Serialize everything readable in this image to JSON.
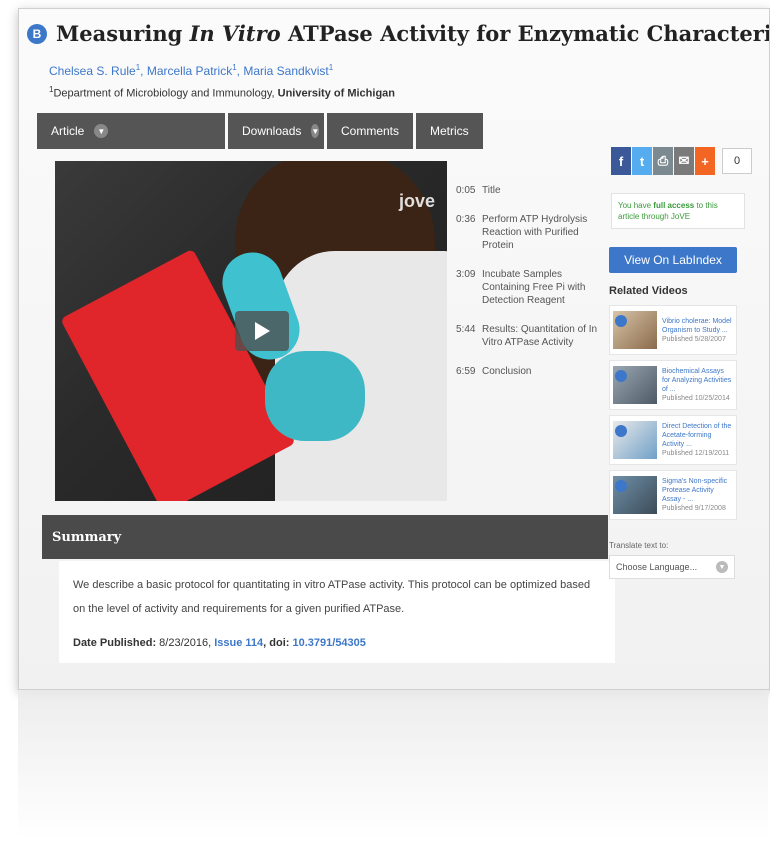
{
  "article": {
    "badge": "B",
    "title_pre": "Measuring ",
    "title_em": "In Vitro",
    "title_post": " ATPase Activity for Enzymatic Characterization",
    "authors": [
      {
        "name": "Chelsea S. Rule",
        "sup": "1"
      },
      {
        "name": "Marcella Patrick",
        "sup": "1"
      },
      {
        "name": "Maria Sandkvist",
        "sup": "1"
      }
    ],
    "affiliation_sup": "1",
    "affiliation_dept": "Department of Microbiology and Immunology, ",
    "affiliation_univ": "University of Michigan"
  },
  "tabs": {
    "article": "Article",
    "downloads": "Downloads",
    "comments": "Comments",
    "metrics": "Metrics"
  },
  "video": {
    "logo": "jove",
    "chapters": [
      {
        "time": "0:05",
        "label": "Title"
      },
      {
        "time": "0:36",
        "label": "Perform ATP Hydrolysis Reaction with Purified Protein"
      },
      {
        "time": "3:09",
        "label": "Incubate Samples Containing Free Pi with Detection Reagent"
      },
      {
        "time": "5:44",
        "label": "Results: Quantitation of In Vitro ATPase Activity"
      },
      {
        "time": "6:59",
        "label": "Conclusion"
      }
    ]
  },
  "social": {
    "count": "0",
    "colors": {
      "facebook": "#3b5998",
      "twitter": "#55acee",
      "print": "#7a8a90",
      "email": "#7a7a7a",
      "plus": "#f26522"
    }
  },
  "sidebar": {
    "access_pre": "You have ",
    "access_bold": "full access",
    "access_post": " to this article through JoVE",
    "labindex_button": "View On LabIndex",
    "related_heading": "Related Videos",
    "related": [
      {
        "title": "Vibrio cholerae: Model Organism to Study ...",
        "published": "Published 5/28/2007"
      },
      {
        "title": "Biochemical Assays for Analyzing Activities of ...",
        "published": "Published 10/25/2014"
      },
      {
        "title": "Direct Detection of the Acetate-forming Activity ...",
        "published": "Published 12/19/2011"
      },
      {
        "title": "Sigma's Non-specific Protease Activity Assay - ...",
        "published": "Published 9/17/2008"
      }
    ],
    "translate_label": "Translate text to:",
    "language_placeholder": "Choose Language..."
  },
  "summary": {
    "heading": "Summary",
    "text": "We describe a basic protocol for quantitating in vitro ATPase activity. This protocol can be optimized based on the level of activity and requirements for a given purified ATPase.",
    "date_label": "Date Published:",
    "date_value": " 8/23/2016, ",
    "issue": "Issue 114",
    "doi_label": ", doi: ",
    "doi": "10.3791/54305"
  },
  "colors": {
    "accent": "#3d77c9",
    "tab_bg": "#555555",
    "summary_bar": "#4a4a4a"
  }
}
